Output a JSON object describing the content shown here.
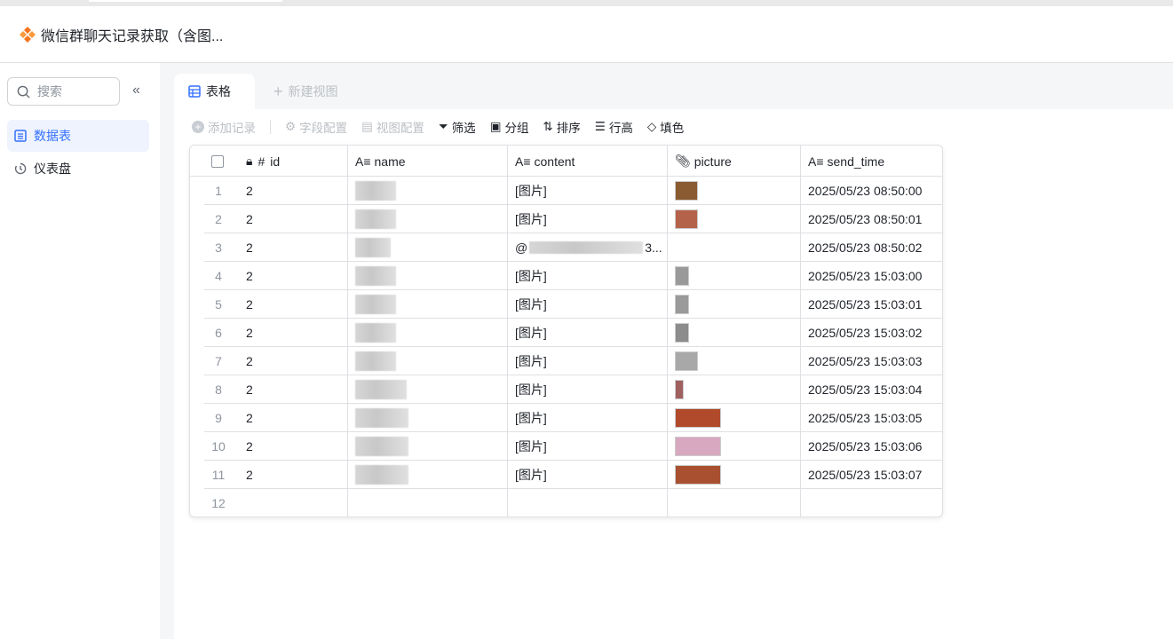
{
  "app": {
    "title": "微信群聊天记录获取（含图...",
    "logo": "orange-diamond-logo"
  },
  "sidebar": {
    "search_placeholder": "搜索",
    "items": [
      {
        "label": "数据表",
        "icon": "table-icon",
        "active": true
      },
      {
        "label": "仪表盘",
        "icon": "dashboard-icon"
      }
    ]
  },
  "views": {
    "tabs": [
      {
        "label": "表格",
        "active": true
      }
    ],
    "new_view": "新建视图"
  },
  "toolbar": {
    "add_record": "添加记录",
    "field_config": "字段配置",
    "view_config": "视图配置",
    "filter": "筛选",
    "group": "分组",
    "sort": "排序",
    "row_height": "行高",
    "fill_color": "填色"
  },
  "table": {
    "columns": [
      {
        "label": "id",
        "icon": "number-icon"
      },
      {
        "label": "name",
        "icon": "text-icon"
      },
      {
        "label": "content",
        "icon": "text-icon"
      },
      {
        "label": "picture",
        "icon": "attachment-icon"
      },
      {
        "label": "send_time",
        "icon": "text-icon"
      }
    ],
    "rows": [
      {
        "n": "1",
        "id": "2",
        "content": "[图片]",
        "thumb": "#8a5a30",
        "send_time": "2025/05/23 08:50:00"
      },
      {
        "n": "2",
        "id": "2",
        "content": "[图片]",
        "thumb": "#b5624a",
        "send_time": "2025/05/23 08:50:01"
      },
      {
        "n": "3",
        "id": "2",
        "content": "@",
        "content_tail": "3...",
        "thumb": "",
        "send_time": "2025/05/23 08:50:02"
      },
      {
        "n": "4",
        "id": "2",
        "content": "[图片]",
        "thumb": "#9a9a9a",
        "send_time": "2025/05/23 15:03:00"
      },
      {
        "n": "5",
        "id": "2",
        "content": "[图片]",
        "thumb": "#9a9a9a",
        "send_time": "2025/05/23 15:03:01"
      },
      {
        "n": "6",
        "id": "2",
        "content": "[图片]",
        "thumb": "#8c8c8c",
        "send_time": "2025/05/23 15:03:02"
      },
      {
        "n": "7",
        "id": "2",
        "content": "[图片]",
        "thumb": "#a8a8a8",
        "send_time": "2025/05/23 15:03:03"
      },
      {
        "n": "8",
        "id": "2",
        "content": "[图片]",
        "thumb": "#a06060",
        "send_time": "2025/05/23 15:03:04"
      },
      {
        "n": "9",
        "id": "2",
        "content": "[图片]",
        "thumb": "#b04a2a",
        "send_time": "2025/05/23 15:03:05"
      },
      {
        "n": "10",
        "id": "2",
        "content": "[图片]",
        "thumb": "#d8a8c0",
        "send_time": "2025/05/23 15:03:06"
      },
      {
        "n": "11",
        "id": "2",
        "content": "[图片]",
        "thumb": "#a85030",
        "send_time": "2025/05/23 15:03:07"
      }
    ],
    "empty_row_number": "12"
  }
}
